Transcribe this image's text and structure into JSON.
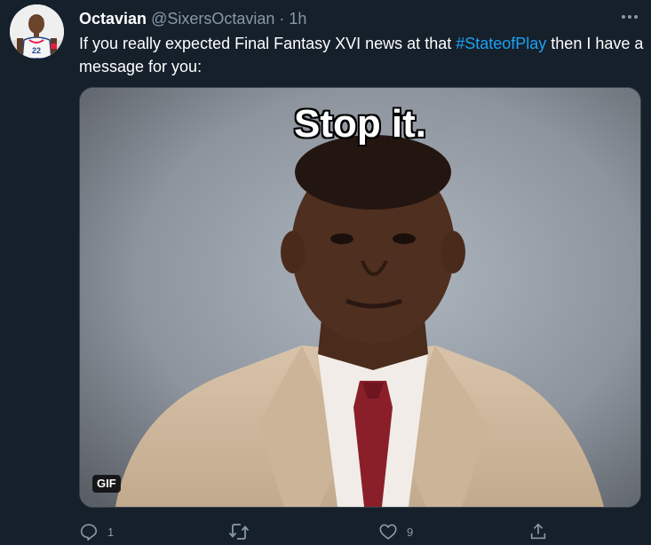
{
  "tweet": {
    "author_name": "Octavian",
    "handle": "@SixersOctavian",
    "separator": "·",
    "timestamp": "1h",
    "text_before": "If you really expected Final Fantasy XVI news at that ",
    "hashtag": "#StateofPlay",
    "text_after": " then I have a message for you:",
    "avatar_jersey_number": "22",
    "more_icon": "more-horizontal-icon"
  },
  "media": {
    "caption": "Stop it.",
    "badge": "GIF"
  },
  "actions": {
    "reply": {
      "icon": "reply-icon",
      "count": "1"
    },
    "retweet": {
      "icon": "retweet-icon",
      "count": ""
    },
    "like": {
      "icon": "heart-icon",
      "count": "9"
    },
    "share": {
      "icon": "share-icon"
    }
  },
  "colors": {
    "background": "#15202b",
    "secondary_text": "#8899a6",
    "accent": "#1da1f2"
  }
}
